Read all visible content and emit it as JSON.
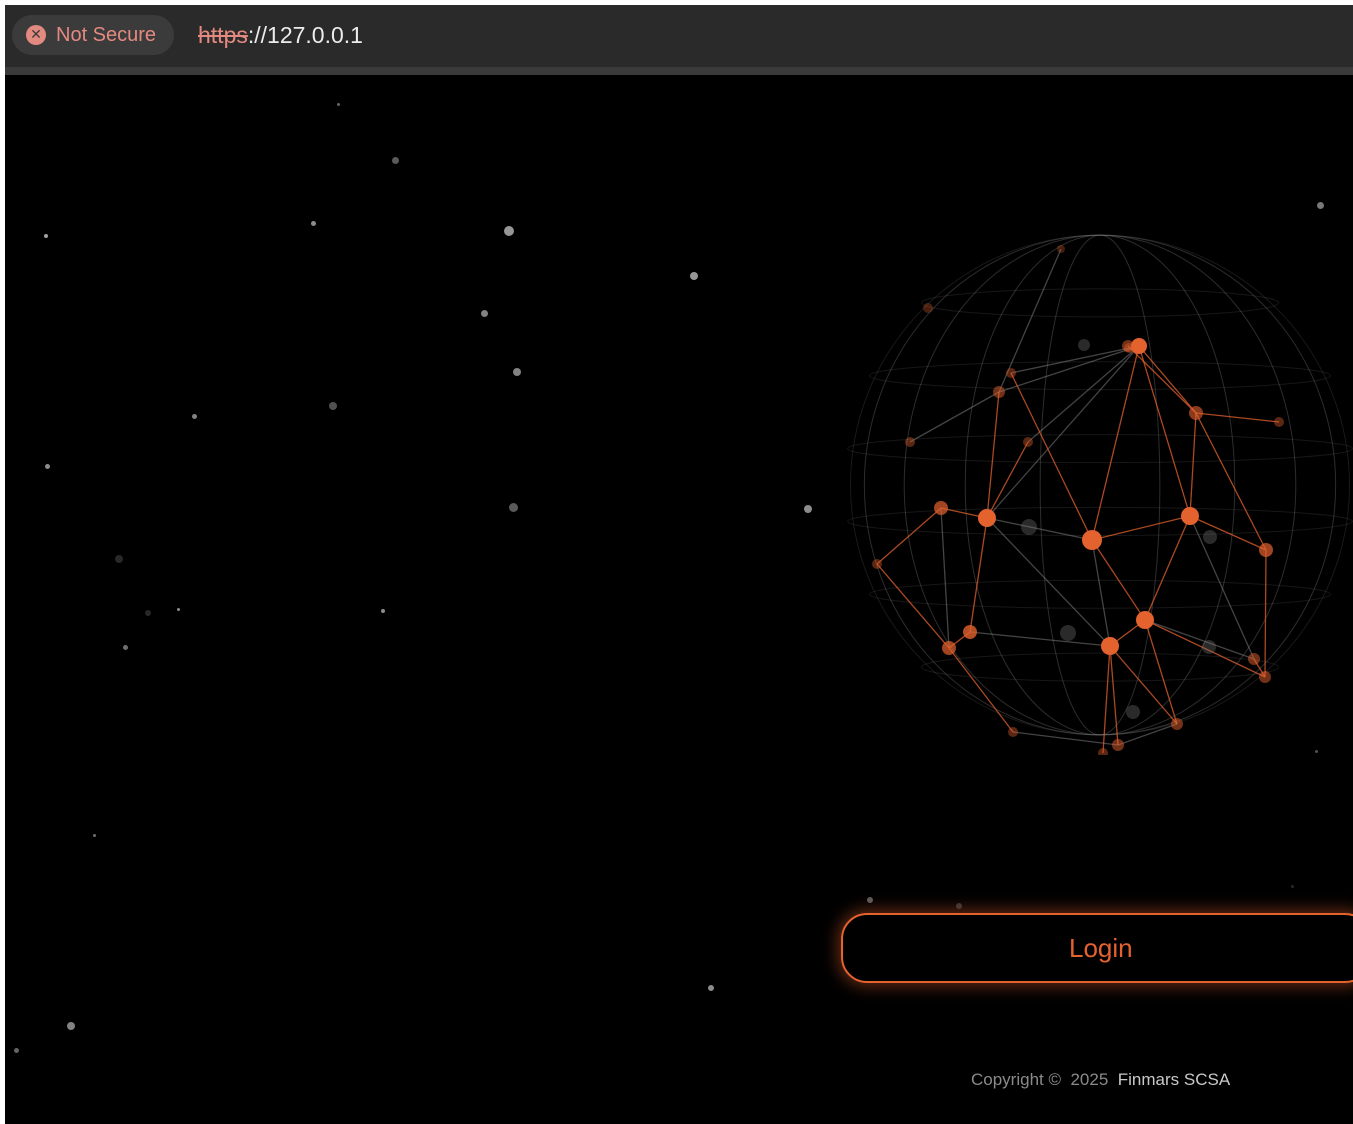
{
  "browser": {
    "security_label": "Not Secure",
    "security_icon": "error-x-icon",
    "url_scheme": "https",
    "url_rest": "://127.0.0.1"
  },
  "login": {
    "button_label": "Login"
  },
  "footer": {
    "copyright_prefix": "Copyright ©",
    "year": "2025",
    "company": "Finmars SCSA"
  },
  "colors": {
    "accent": "#e4622e",
    "background": "#000000",
    "security_warning": "#e38a80"
  }
}
